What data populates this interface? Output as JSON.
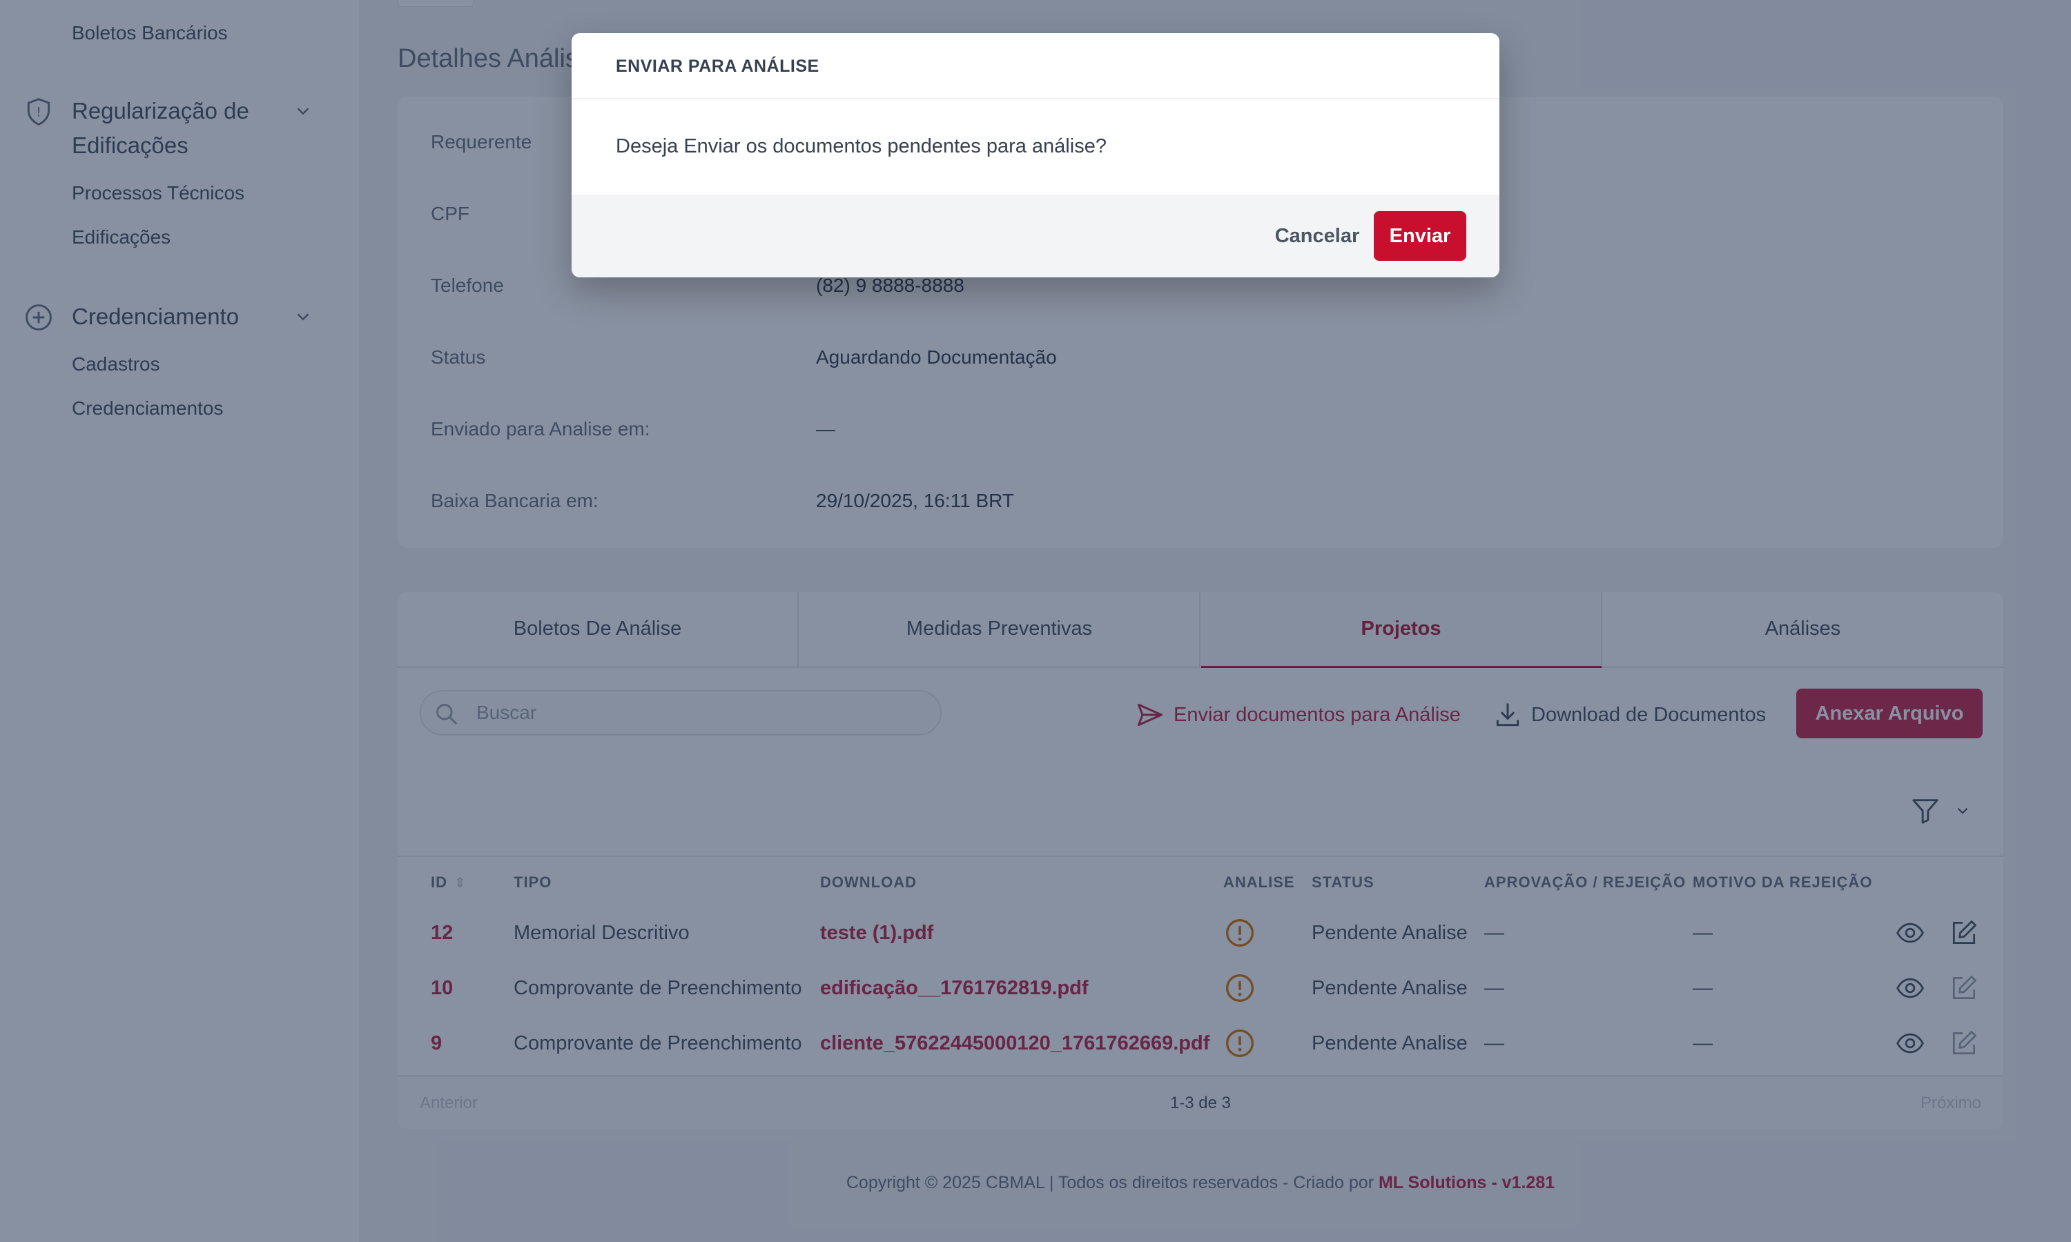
{
  "sidebar": {
    "top_link": "Boletos Bancários",
    "groups": [
      {
        "label_line1": "Regularização de",
        "label_line2": "Edificações",
        "icon": "shield-icon",
        "items": [
          "Processos Técnicos",
          "Edificações"
        ]
      },
      {
        "label": "Credenciamento",
        "icon": "plus-circle-icon",
        "items": [
          "Cadastros",
          "Credenciamentos"
        ]
      }
    ]
  },
  "page": {
    "title": "Detalhes Análise"
  },
  "details": [
    {
      "key": "Requerente",
      "value": ""
    },
    {
      "key": "CPF",
      "value": ""
    },
    {
      "key": "Telefone",
      "value": "(82) 9 8888-8888"
    },
    {
      "key": "Status",
      "value": "Aguardando Documentação"
    },
    {
      "key": "Enviado para Analise em:",
      "value": "—"
    },
    {
      "key": "Baixa Bancaria em:",
      "value": "29/10/2025, 16:11 BRT"
    }
  ],
  "tabs": [
    "Boletos De Análise",
    "Medidas Preventivas",
    "Projetos",
    "Análises"
  ],
  "toolbar": {
    "search_placeholder": "Buscar",
    "send_label": "Enviar documentos para Análise",
    "download_label": "Download de Documentos",
    "attach_label": "Anexar Arquivo"
  },
  "table": {
    "headers": [
      "ID",
      "TIPO",
      "DOWNLOAD",
      "ANALISE",
      "STATUS",
      "APROVAÇÃO / REJEIÇÃO",
      "MOTIVO DA REJEIÇÃO"
    ],
    "rows": [
      {
        "id": "12",
        "tipo": "Memorial Descritivo",
        "download": "teste (1).pdf",
        "status": "Pendente Analise",
        "aprovacao": "—",
        "motivo": "—"
      },
      {
        "id": "10",
        "tipo": "Comprovante de Preenchimento",
        "download": "edificação__1761762819.pdf",
        "status": "Pendente Analise",
        "aprovacao": "—",
        "motivo": "—"
      },
      {
        "id": "9",
        "tipo": "Comprovante de Preenchimento",
        "download": "cliente_57622445000120_1761762669.pdf",
        "status": "Pendente Analise",
        "aprovacao": "—",
        "motivo": "—"
      }
    ]
  },
  "pager": {
    "prev": "Anterior",
    "info": "1-3 de 3",
    "next": "Próximo"
  },
  "footer": {
    "text": "Copyright © 2025 CBMAL | Todos os direitos reservados - Criado por ",
    "brand": "ML Solutions - v1.281"
  },
  "modal": {
    "title": "ENVIAR PARA ANÁLISE",
    "message": "Deseja Enviar os documentos pendentes para análise?",
    "cancel_label": "Cancelar",
    "confirm_label": "Enviar"
  },
  "colors": {
    "accent": "#c0264a",
    "confirm": "#c8102e",
    "warning": "#d97706",
    "overlay": "#112344"
  }
}
